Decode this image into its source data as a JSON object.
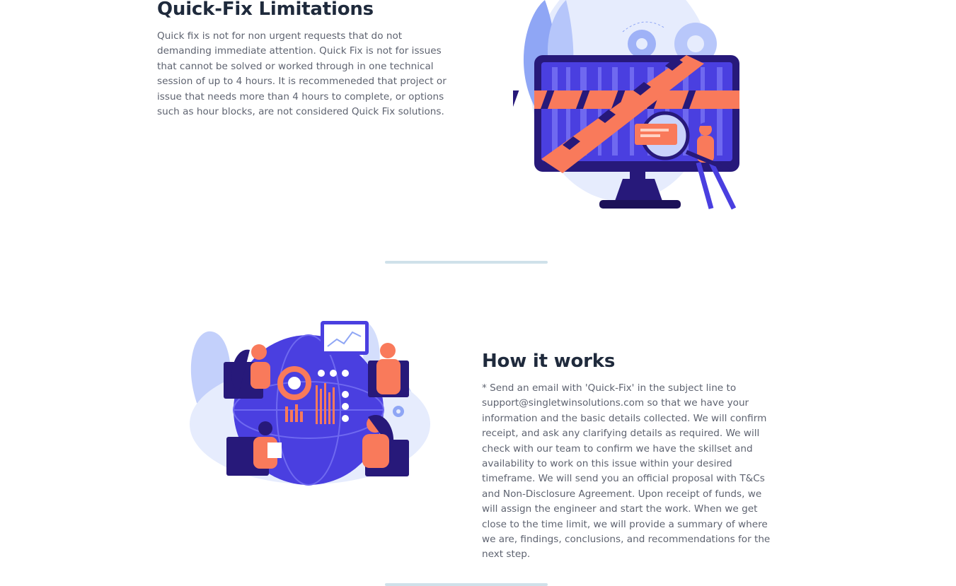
{
  "sections": [
    {
      "title": "Quick-Fix Limitations",
      "body": "Quick fix is not for non urgent requests that do not demanding immediate attention. Quick Fix is not for issues that cannot be solved or worked through in one technical session of up to 4 hours. It is recommeneded that project or issue that needs more than 4 hours to complete, or options such as hour blocks, are not considered Quick Fix solutions.",
      "illustration": "monitor-with-caution-tape-illustration"
    },
    {
      "title": "How it works",
      "body": "* Send an email with 'Quick-Fix' in the subject line to support@singletwinsolutions.com so that we have your information and the basic details collected. We will confirm receipt, and ask any clarifying details as required. We will check with our team to confirm we have the skillset and availability to work on this issue within your desired timeframe. We will send you an official proposal with T&Cs and Non-Disclosure Agreement. Upon receipt of funds, we will assign the engineer and start the work. When we get close to the time limit, we will provide a summary of where we are, findings, conclusions, and recommendations for the next step.",
      "illustration": "team-collaboration-globe-illustration"
    }
  ],
  "colors": {
    "heading": "#1f2a3c",
    "body": "#5e6370",
    "divider": "#cfe1ea",
    "illustration_primary": "#4a3fe0",
    "illustration_accent": "#f97a5b"
  }
}
